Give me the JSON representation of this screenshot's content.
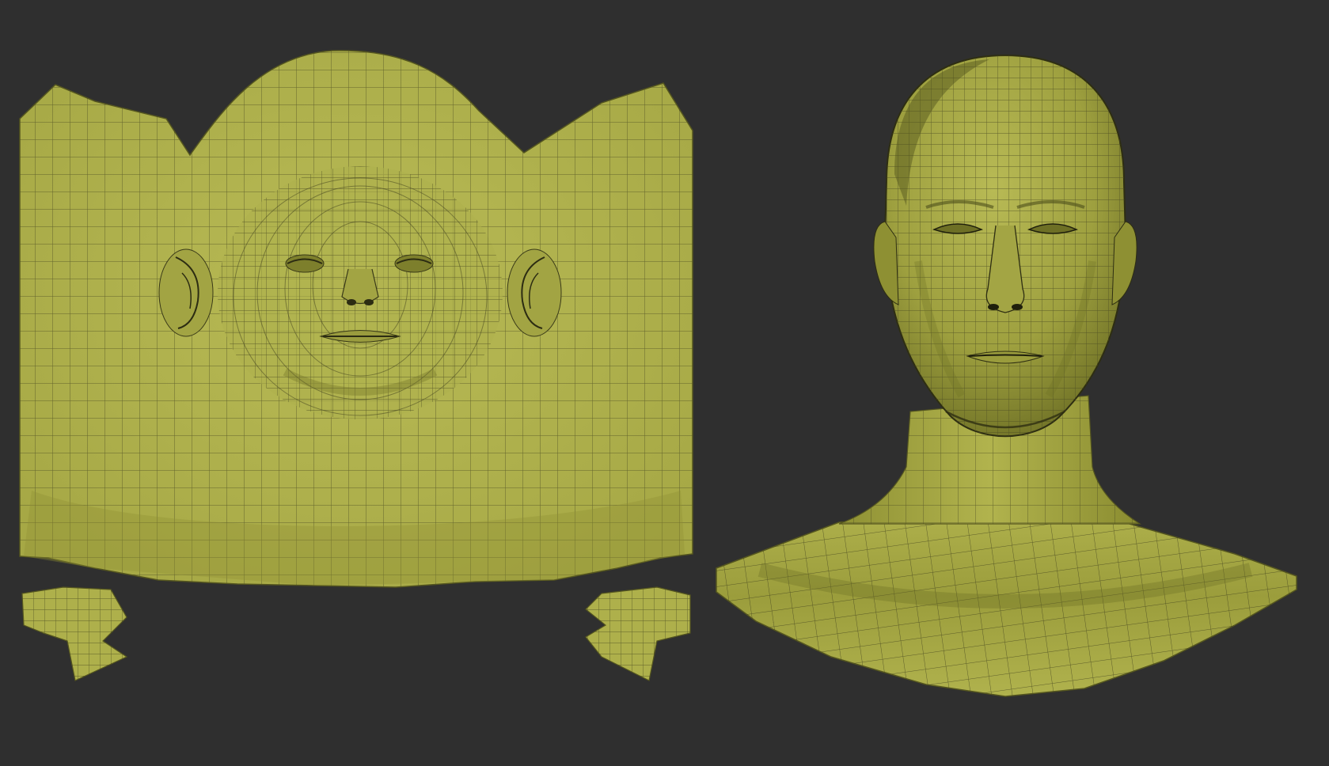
{
  "scene": {
    "background_color": "#2f2f2f",
    "mesh_fill_color": "#b3b54f",
    "mesh_shadow_color": "#6f7125",
    "wire_color": "#4a4a22",
    "objects": [
      {
        "id": "uv-layout",
        "kind": "unwrapped face UV map",
        "pieces": [
          "main-face-shell",
          "left-ear-island",
          "right-ear-island"
        ]
      },
      {
        "id": "head-mesh",
        "kind": "3D head and neck wireframe mesh"
      }
    ]
  }
}
